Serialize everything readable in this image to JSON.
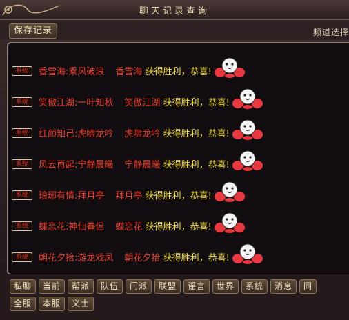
{
  "window": {
    "title": "聊天记录查询"
  },
  "toolbar": {
    "save_label": "保存记录",
    "channel_label": "频道选择"
  },
  "log": [
    {
      "tag": "系统",
      "name": "香雪海",
      "partner": "乘风破浪",
      "again": "香雪海",
      "msg": "获得胜利，恭喜!"
    },
    {
      "tag": "系统",
      "name": "笑傲江湖",
      "partner": "一叶知秋",
      "again": "笑傲江湖",
      "msg": "获得胜利，恭喜!"
    },
    {
      "tag": "系统",
      "name": "红颜知己",
      "partner": "虎啸龙吟",
      "again": "虎啸龙吟",
      "msg": "获得胜利，恭喜!"
    },
    {
      "tag": "系统",
      "name": "风云再起",
      "partner": "宁静晨曦",
      "again": "宁静晨曦",
      "msg": "获得胜利，恭喜!"
    },
    {
      "tag": "系统",
      "name": "琅琊有情",
      "partner": "拜月亭",
      "again": "拜月亭",
      "msg": "获得胜利，恭喜!"
    },
    {
      "tag": "系统",
      "name": "蝶恋花",
      "partner": "神仙眷侣",
      "again": "蝶恋花",
      "msg": "获得胜利，恭喜!"
    },
    {
      "tag": "系统",
      "name": "朝花夕拾",
      "partner": "游龙戏凤",
      "again": "朝花夕拾",
      "msg": "获得胜利，恭喜!"
    }
  ],
  "channels_row1": [
    "私聊",
    "当前",
    "帮派",
    "队伍",
    "门派",
    "联盟",
    "谣言",
    "世界",
    "系统",
    "消息",
    "同"
  ],
  "channels_row2": [
    "全服",
    "本服",
    "义士"
  ],
  "colors": {
    "name": "#e8402f",
    "message": "#f2e04a",
    "border": "#8a8078"
  }
}
